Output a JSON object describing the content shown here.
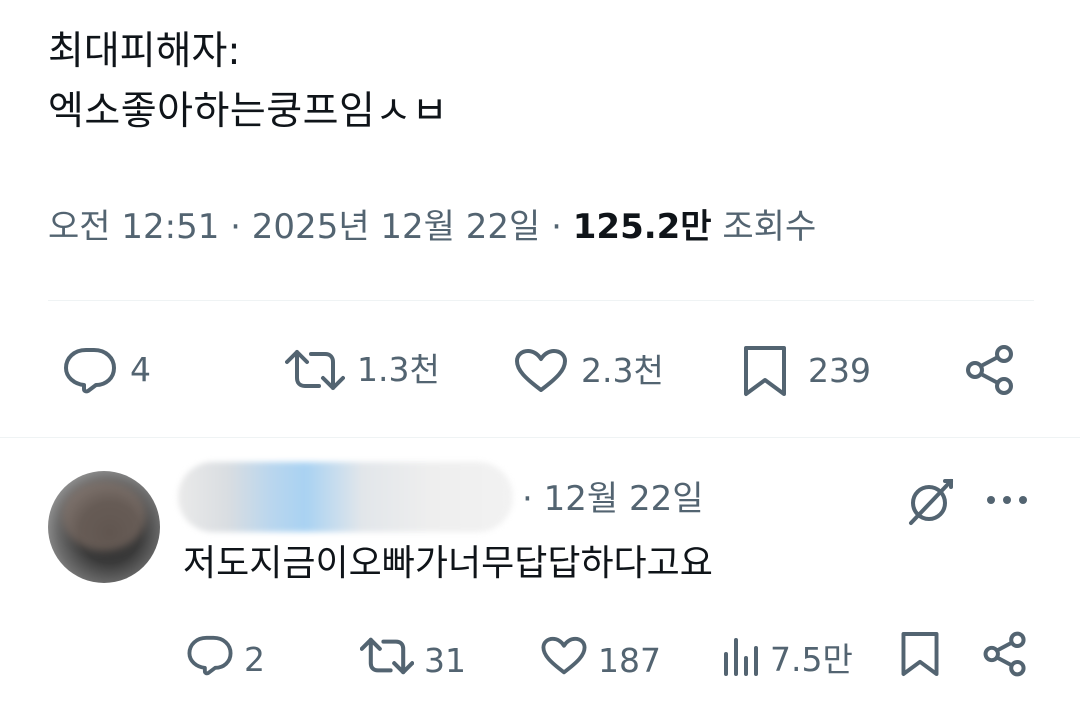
{
  "tweet": {
    "line1": "최대피해자:",
    "line2": "엑소좋아하는쿵프임ㅅㅂ",
    "time": "오전 12:51",
    "separator": "·",
    "date": "2025년 12월 22일",
    "views_count": "125.2만",
    "views_label": "조회수"
  },
  "tweet_actions": {
    "replies": "4",
    "retweets": "1.3천",
    "likes": "2.3천",
    "bookmarks": "239"
  },
  "reply": {
    "date": "· 12월 22일",
    "text": "저도지금이오빠가너무답답하다고요",
    "actions": {
      "replies": "2",
      "retweets": "31",
      "likes": "187",
      "views": "7.5만"
    }
  },
  "icons": {
    "reply": "comment-bubble-icon",
    "retweet": "retweet-icon",
    "like": "heart-icon",
    "bookmark": "bookmark-icon",
    "share": "share-icon",
    "views": "analytics-bars-icon",
    "grok": "grok-icon",
    "more": "more-dots-icon"
  },
  "colors": {
    "text_primary": "#0f1419",
    "text_secondary": "#536471",
    "divider": "#eff3f4"
  }
}
